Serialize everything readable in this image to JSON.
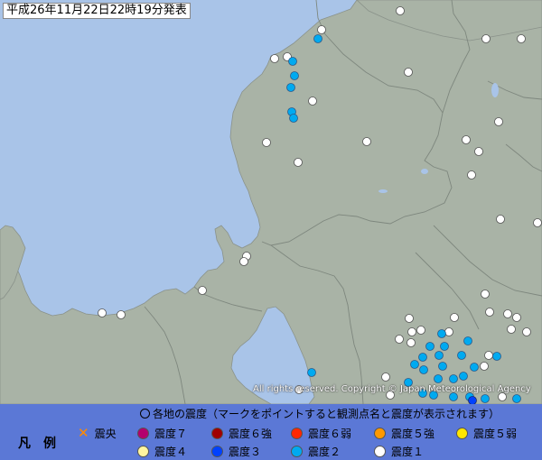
{
  "map": {
    "timestamp": "平成26年11月22日22時19分発表",
    "copyright": "All rights reserved. Copyright © Japan Meteorological Agency",
    "colors": {
      "sea": "#a9c4e8",
      "land": "#a9b3a6",
      "lake": "#a9c4e8",
      "boundary": "#8a928a"
    }
  },
  "legend": {
    "title": "凡例",
    "note_circle_icon": "open-circle-icon",
    "note": "各地の震度（マークをポイントすると観測点名と震度が表示されます）",
    "epicenter": {
      "label": "震央",
      "icon": "x-mark-icon",
      "color": "#ff8a00"
    },
    "intensities": [
      {
        "label": "震度７",
        "color": "#b4006e"
      },
      {
        "label": "震度６強",
        "color": "#a00000"
      },
      {
        "label": "震度６弱",
        "color": "#ff2800"
      },
      {
        "label": "震度５強",
        "color": "#ff9900"
      },
      {
        "label": "震度５弱",
        "color": "#ffe600"
      },
      {
        "label": "震度４",
        "color": "#fff5a0"
      },
      {
        "label": "震度３",
        "color": "#0041ff"
      },
      {
        "label": "震度２",
        "color": "#00aaf0"
      },
      {
        "label": "震度１",
        "color": "#ffffff"
      }
    ]
  }
}
